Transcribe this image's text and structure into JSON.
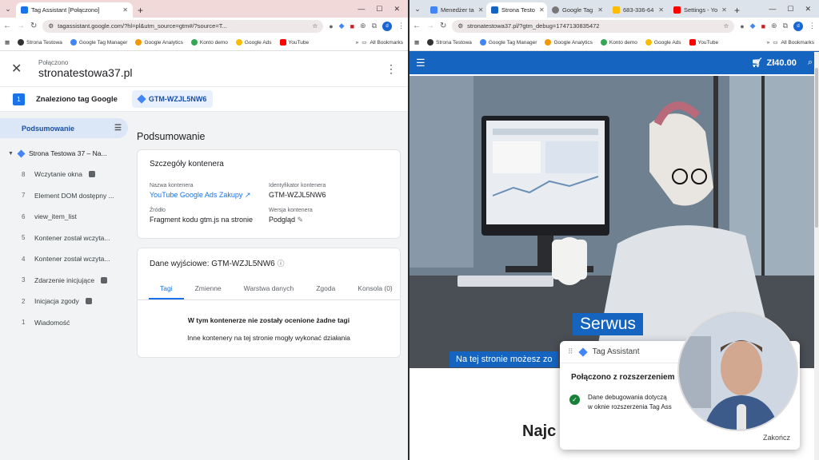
{
  "left": {
    "tab_title": "Tag Assistant [Połączono]",
    "url": "tagassistant.google.com/?hl=pl&utm_source=gtm#/?source=T...",
    "bookmarks": [
      "Strona Testowa",
      "Google Tag Manager",
      "Google Analytics",
      "Konto demo",
      "Google Ads",
      "YouTube"
    ],
    "all_bookmarks": "All Bookmarks",
    "ta": {
      "connected_label": "Połączono",
      "domain": "stronatestowa37.pl",
      "found_count": "1",
      "found_label": "Znaleziono tag Google",
      "gtm_id": "GTM-WZJL5NW6"
    },
    "sidebar": {
      "summary": "Podsumowanie",
      "page": "Strona Testowa 37 – Na...",
      "items": [
        {
          "n": "8",
          "label": "Wczytanie okna",
          "badge": true
        },
        {
          "n": "7",
          "label": "Element DOM dostępny ...",
          "badge": false
        },
        {
          "n": "6",
          "label": "view_item_list",
          "badge": false
        },
        {
          "n": "5",
          "label": "Kontener został wczyta...",
          "badge": false
        },
        {
          "n": "4",
          "label": "Kontener został wczyta...",
          "badge": false
        },
        {
          "n": "3",
          "label": "Zdarzenie inicjujące",
          "badge": true
        },
        {
          "n": "2",
          "label": "Inicjacja zgody",
          "badge": true
        },
        {
          "n": "1",
          "label": "Wiadomość",
          "badge": false
        }
      ]
    },
    "main": {
      "title": "Podsumowanie",
      "details_title": "Szczegóły kontenera",
      "container_name_label": "Nazwa kontenera",
      "container_name": "YouTube Google Ads Zakupy",
      "container_id_label": "Identyfikator kontenera",
      "container_id": "GTM-WZJL5NW6",
      "source_label": "Źródło",
      "source": "Fragment kodu gtm.js na stronie",
      "version_label": "Wersja kontenera",
      "version": "Podgląd",
      "output_title": "Dane wyjściowe: GTM-WZJL5NW6",
      "tabs": [
        "Tagi",
        "Zmienne",
        "Warstwa danych",
        "Zgoda",
        "Konsola (0)"
      ],
      "empty_bold": "W tym kontenerze nie zostały ocenione żadne tagi",
      "empty_note": "Inne kontenery na tej stronie mogły wykonać działania"
    }
  },
  "right": {
    "tabs": [
      "Menedżer ta",
      "Strona Testo",
      "Google Tag",
      "683-336-64",
      "Settings - Yo"
    ],
    "url": "stronatestowa37.pl/?gtm_debug=1747130835472",
    "bookmarks": [
      "Strona Testowa",
      "Google Tag Manager",
      "Google Analytics",
      "Konto demo",
      "Google Ads",
      "YouTube"
    ],
    "all_bookmarks": "All Bookmarks",
    "cart_total": "Zł40.00",
    "hero_heading": "Serwus",
    "hero_sub": "Na tej stronie możesz zo",
    "below_heading": "Najc",
    "popup": {
      "title": "Tag Assistant",
      "connected": "Połączono z rozszerzeniem",
      "msg_line1": "Dane debugowania dotyczą",
      "msg_line2": "w oknie rozszerzenia Tag Ass",
      "end": "Zakończ"
    }
  }
}
